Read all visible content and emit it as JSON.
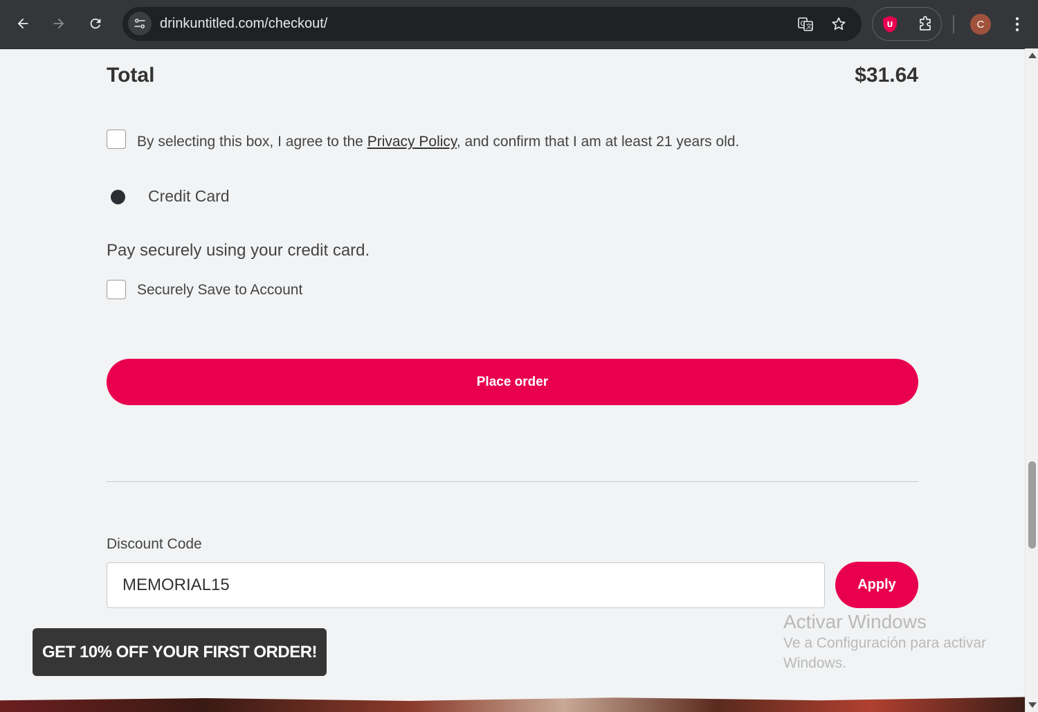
{
  "browser": {
    "url": "drinkuntitled.com/checkout/",
    "avatar_letter": "C"
  },
  "order": {
    "total_label": "Total",
    "total_value": "$31.64"
  },
  "agreement": {
    "text_before": "By selecting this box, I agree to the ",
    "link": "Privacy Policy",
    "text_after": ", and confirm that I am at least 21 years old.",
    "checked": false
  },
  "payment": {
    "method_label": "Credit Card",
    "description": "Pay securely using your credit card.",
    "save_label": "Securely Save to Account"
  },
  "actions": {
    "place_order": "Place order"
  },
  "discount": {
    "label": "Discount Code",
    "value": "MEMORIAL15",
    "apply": "Apply"
  },
  "promo": {
    "text": "GET 10% OFF YOUR FIRST ORDER!"
  },
  "watermark": {
    "line1": "Activar Windows",
    "line2": "Ve a Configuración para activar Windows."
  },
  "colors": {
    "accent": "#e8004f",
    "page_bg": "#f2f3f4",
    "chrome_bg": "#35363a"
  }
}
